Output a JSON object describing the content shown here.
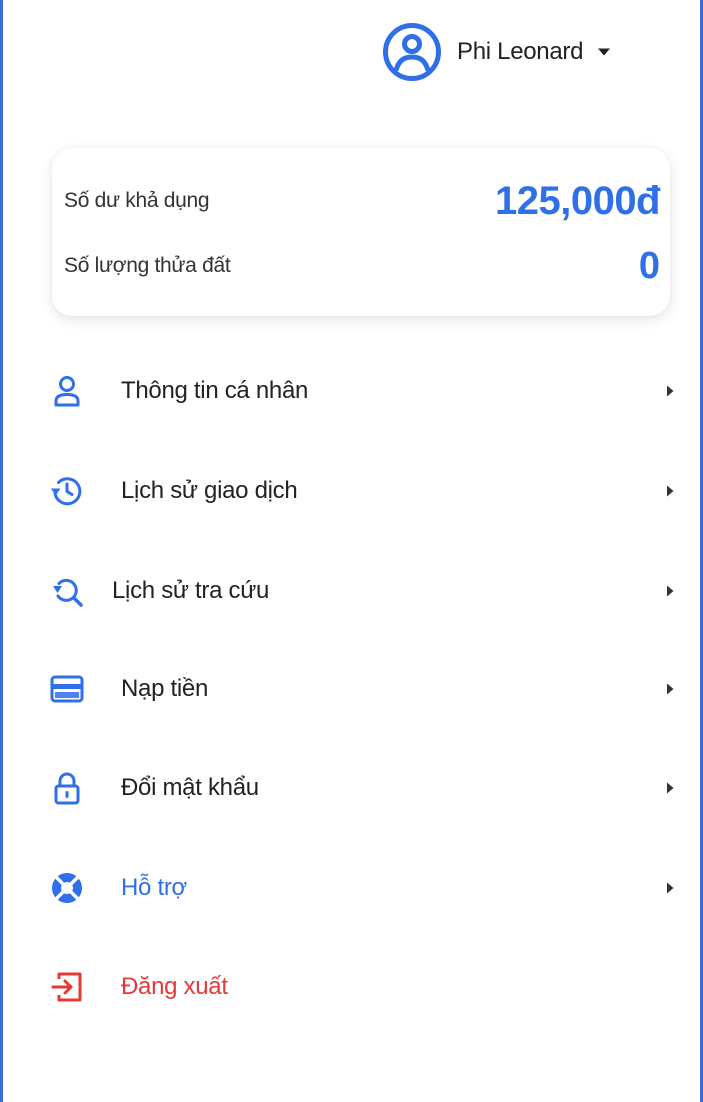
{
  "header": {
    "user_name": "Phi Leonard",
    "avatar_icon": "user-circle-icon",
    "dropdown_icon": "caret-down-icon"
  },
  "balance_card": {
    "available_balance_label": "Số dư khả dụng",
    "available_balance_value": "125,000đ",
    "land_plots_label": "Số lượng thửa đất",
    "land_plots_value": "0"
  },
  "menu": {
    "items": [
      {
        "label": "Thông tin cá nhân",
        "icon": "user-icon",
        "has_arrow": true
      },
      {
        "label": "Lịch sử giao dịch",
        "icon": "history-icon",
        "has_arrow": true
      },
      {
        "label": "Lịch sử tra cứu",
        "icon": "search-history-icon",
        "has_arrow": true
      },
      {
        "label": "Nạp tiền",
        "icon": "credit-card-icon",
        "has_arrow": true
      },
      {
        "label": "Đổi mật khẩu",
        "icon": "lock-icon",
        "has_arrow": true
      },
      {
        "label": "Hỗ trợ",
        "icon": "lifebuoy-icon",
        "has_arrow": true
      },
      {
        "label": "Đăng xuất",
        "icon": "logout-icon",
        "has_arrow": false
      }
    ]
  },
  "colors": {
    "accent": "#2f6fe8",
    "danger": "#e53935",
    "frame_border": "#3b6fd8"
  }
}
